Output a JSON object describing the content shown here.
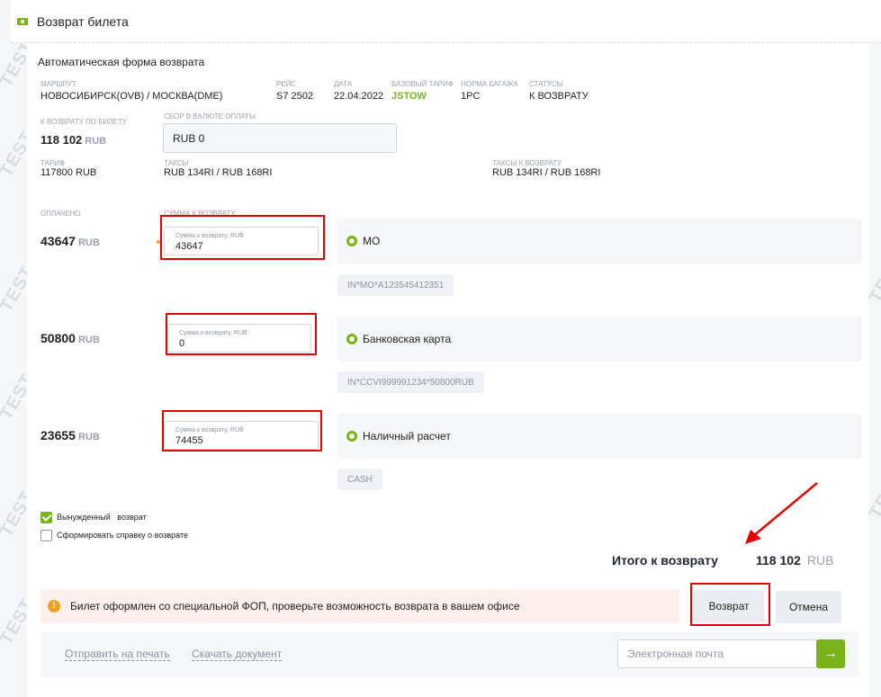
{
  "header": {
    "title": "Возврат билета",
    "watermark": "TEST"
  },
  "form": {
    "title": "Автоматическая форма возврата",
    "route": {
      "label": "МАРШРУТ",
      "value": "НОВОСИБИРСК(OVB) / МОСКВА(DME)"
    },
    "flight": {
      "label": "РЕЙС",
      "value": "S7 2502"
    },
    "date": {
      "label": "ДАТА",
      "value": "22.04.2022"
    },
    "base_fare": {
      "label": "БАЗОВЫЙ ТАРИФ",
      "value": "JSTOW"
    },
    "baggage": {
      "label": "НОРМА БАГАЖА",
      "value": "1PC"
    },
    "status": {
      "label": "СТАТУСЫ",
      "value": "К ВОЗВРАТУ"
    },
    "refund_ticket": {
      "label": "К ВОЗВРАТУ ПО БИЛЕТУ",
      "amount": "118 102",
      "currency": "RUB"
    },
    "fee": {
      "label": "СБОР В ВАЛЮТЕ ОПЛАТЫ",
      "value": "RUB 0"
    },
    "tariff": {
      "label": "ТАРИФ",
      "value": "117800 RUB"
    },
    "taxes": {
      "label": "ТАКСЫ",
      "value": "RUB 134RI / RUB 168RI"
    },
    "taxes_refund": {
      "label": "ТАКСЫ К ВОЗВРАТУ",
      "value": "RUB 134RI / RUB 168RI"
    },
    "paid_label": "ОПЛАЧЕНО",
    "refund_sum_label": "СУММА К ВОЗВРАТУ",
    "payments": [
      {
        "paid": "43647",
        "currency": "RUB",
        "field_label": "Сумма к возврату, RUB",
        "field_value": "43647",
        "method": "МО",
        "code": "IN*MO*A123545412351"
      },
      {
        "paid": "50800",
        "currency": "RUB",
        "field_label": "Сумма к возврату, RUB",
        "field_value": "0",
        "method": "Банковская карта",
        "code": "IN*CCVI999991234*50800RUB"
      },
      {
        "paid": "23655",
        "currency": "RUB",
        "field_label": "Сумма к возврату, RUB",
        "field_value": "74455",
        "method": "Наличный расчет",
        "code": "CASH"
      }
    ],
    "forced_refund": {
      "label": "Вынужденный   возврат",
      "checked": true
    },
    "make_certificate": {
      "label": "Сформировать справку о возврате",
      "checked": false
    },
    "total": {
      "label": "Итого к возврату",
      "amount": "118 102",
      "currency": "RUB"
    },
    "warning": "Билет оформлен со специальной ФОП, проверьте возможность возврата в вашем офисе",
    "refund_button": "Возврат",
    "cancel_button": "Отмена"
  },
  "footer": {
    "print_link": "Отправить на печать",
    "download_link": "Скачать документ",
    "email_placeholder": "Электронная почта",
    "send_icon": "arrow-right-icon"
  },
  "colors": {
    "accent": "#7ab317",
    "annotation": "#e00000",
    "warning": "#f0a01a"
  }
}
